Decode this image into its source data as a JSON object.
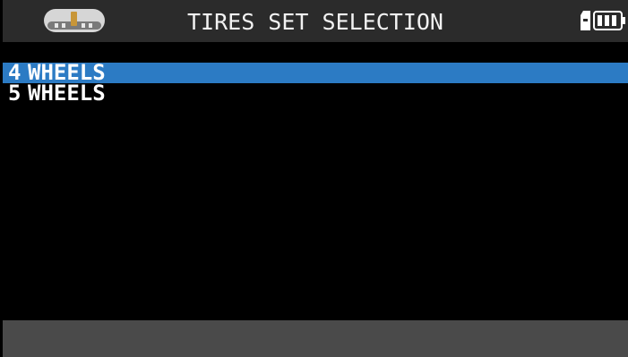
{
  "header": {
    "title": "TIRES SET SELECTION",
    "logo_icon": "tire-tool-logo-icon",
    "storage_icon": "sd-card-icon",
    "battery_icon": "battery-icon",
    "battery_level": 1.0
  },
  "menu": {
    "items": [
      {
        "number": "4",
        "label": "WHEELS",
        "selected": true
      },
      {
        "number": "5",
        "label": "WHEELS",
        "selected": false
      }
    ]
  },
  "colors": {
    "header_bg": "#2b2b2b",
    "screen_bg": "#000000",
    "selection": "#2c7bc4",
    "footer_bg": "#4a4a4a",
    "text": "#ffffff"
  }
}
